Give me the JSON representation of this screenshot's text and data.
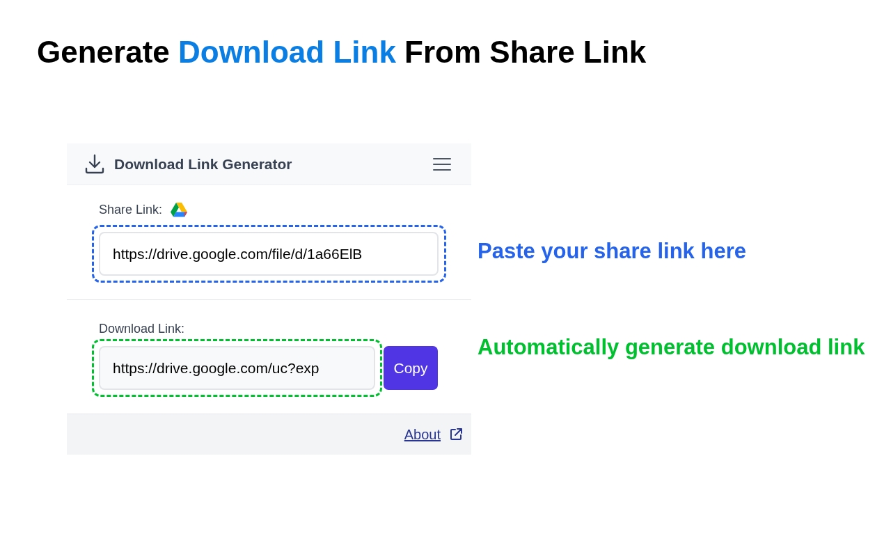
{
  "heading": [
    {
      "text": "Generate ",
      "highlighted": false
    },
    {
      "text": "Download Link",
      "highlighted": true
    },
    {
      "text": " From Share Link",
      "highlighted": false
    }
  ],
  "app": {
    "title": "Download Link Generator",
    "share": {
      "label": "Share Link:",
      "value": "https://drive.google.com/file/d/1a66ElB"
    },
    "download": {
      "label": "Download Link:",
      "value": "https://drive.google.com/uc?exp",
      "button": "Copy"
    },
    "footer_link": "About"
  },
  "callouts": [
    {
      "text": "Paste your share link here",
      "color": "#2563eb"
    },
    {
      "text": "Automatically generate download link",
      "color": "#00c030"
    }
  ]
}
